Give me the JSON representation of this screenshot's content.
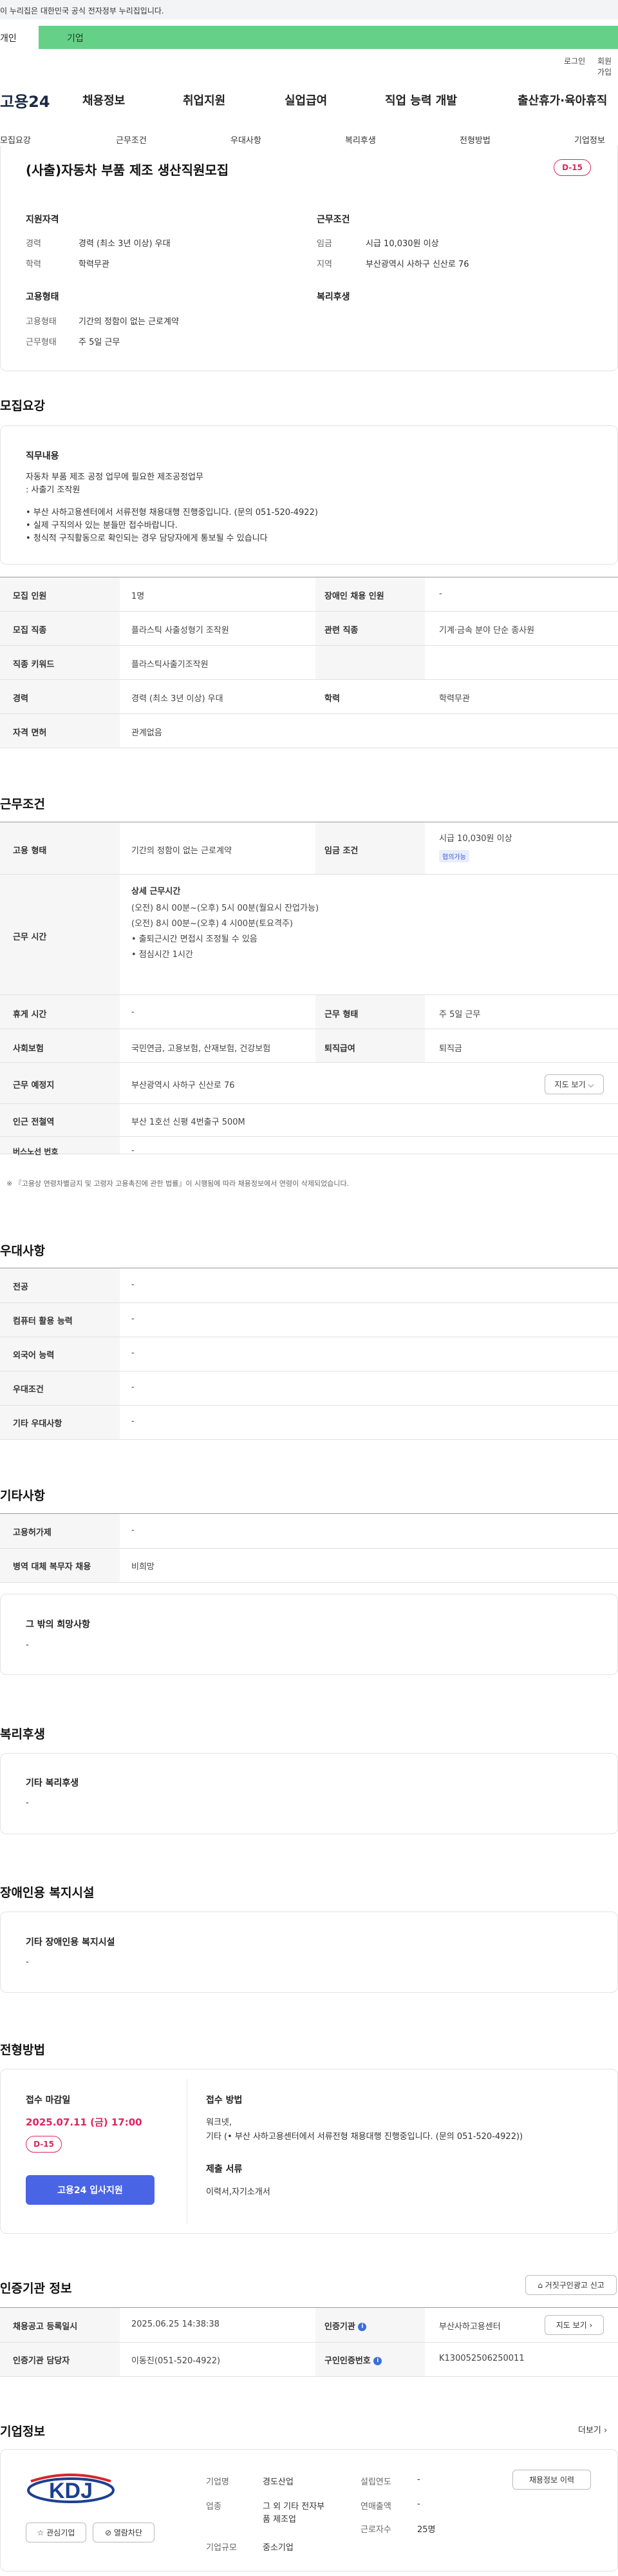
{
  "notice": "이 누리집은 대한민국 공식 전자정부 누리집입니다.",
  "top_tabs": [
    "개인",
    "기업"
  ],
  "util": [
    "로그인",
    "회원가입"
  ],
  "logo": "고용24",
  "gnb": [
    "채용정보",
    "취업지원",
    "실업급여",
    "직업 능력 개발",
    "출산휴가·육아휴직"
  ],
  "subtabs": [
    "모집요강",
    "근무조건",
    "우대사항",
    "복리후생",
    "전형방법",
    "기업정보"
  ],
  "job": {
    "title": "(사출)자동차 부품 제조 생산직원모집",
    "dday": "D-15",
    "qual_h": "지원자격",
    "work_h": "근무조건",
    "emp_h": "고용형태",
    "welfare_h": "복리후생",
    "career_k": "경력",
    "career_v": "경력 (최소 3년 이상) 우대",
    "edu_k": "학력",
    "edu_v": "학력무관",
    "wage_k": "임금",
    "wage_v": "시급 10,030원 이상",
    "region_k": "지역",
    "region_v": "부산광역시 사하구 신산로 76",
    "etype_k": "고용형태",
    "etype_v": "기간의 정함이 없는 근로계약",
    "wtype_k": "근무형태",
    "wtype_v": "주 5일 근무"
  },
  "sections": {
    "recruit": "모집요강",
    "work": "근무조건",
    "pref": "우대사항",
    "etc": "기타사항",
    "welfare": "복리후생",
    "disab": "장애인용 복지시설",
    "screen": "전형방법",
    "cert": "인증기관 정보",
    "company": "기업정보"
  },
  "duty": {
    "h": "직무내용",
    "l1": "자동차 부품 제조 공정 업무에 필요한 제조공정업무",
    "l2": ": 사출기 조작원",
    "l3": "• 부산 사하고용센터에서 서류전형 채용대행 진행중입니다. (문의 051-520-4922)",
    "l4": "• 실제 구직의사 있는 분들만 접수바랍니다.",
    "l5": "• 청식적 구직활동으로 확인되는 경우 담당자에게 통보될 수 있습니다"
  },
  "recruit_table": {
    "r1": [
      "모집 인원",
      "1명",
      "장애인 채용 인원",
      "-"
    ],
    "r2": [
      "모집 직종",
      "플라스틱 사출성형기 조작원",
      "관련 직종",
      "기계·금속 분야 단순 종사원"
    ],
    "r3": [
      "직종 키워드",
      "플라스틱사출기조작원"
    ],
    "r4": [
      "경력",
      "경력 (최소 3년 이상) 우대",
      "학력",
      "학력무관"
    ],
    "r5": [
      "자격 면허",
      "관계없음"
    ]
  },
  "work_table": {
    "etype": [
      "고용 형태",
      "기간의 정함이 없는 근로계약"
    ],
    "wage": [
      "임금 조건",
      "시급 10,030원 이상"
    ],
    "wage_chip": "협의가능",
    "hours_k": "근무 시간",
    "hours": [
      "상세 근무시간",
      "(오전) 8시 00분~(오후) 5시 00분(월요시 잔업가능)",
      "(오전) 8시 00분~(오후) 4 시00분(토요격주)",
      "• 출퇴근시간 면접시 조정될 수 있음",
      "• 점심시간 1시간"
    ],
    "leave": [
      "휴게 시간",
      "-",
      "근무 형태",
      "주 5일 근무"
    ],
    "ins": [
      "사회보험",
      "국민연금, 고용보험, 산재보험, 건강보험",
      "퇴직급여",
      "퇴직금"
    ],
    "place": [
      "근무 예정지",
      "부산광역시 사하구 신산로 76"
    ],
    "map_btn": "지도 보기 ⌵",
    "station": [
      "인근 전철역",
      "부산 1호선 신평 4번출구 500M"
    ],
    "bus": [
      "버스노선 번호",
      "-"
    ],
    "note": "※ 『고용상 연령차별금지 및 고령자 고용촉진에 관한 법률』이 시행됨에 따라 채용정보에서 연령이 삭제되었습니다."
  },
  "pref_table": [
    [
      "전공",
      "-"
    ],
    [
      "컴퓨터 활용 능력",
      "-"
    ],
    [
      "외국어 능력",
      "-"
    ],
    [
      "우대조건",
      "-"
    ],
    [
      "기타 우대사항",
      "-"
    ]
  ],
  "etc_table": [
    [
      "고용허가제",
      "-"
    ],
    [
      "병역 대체 복무자 채용",
      "비희망"
    ]
  ],
  "etc_box": {
    "h": "그 밖의 희망사항",
    "v": "-"
  },
  "welfare_box": {
    "h": "기타 복리후생",
    "v": "-"
  },
  "disab_box": {
    "h": "기타 장애인용 복지시설",
    "v": "-"
  },
  "screen_box": {
    "deadline_h": "접수 마감일",
    "deadline": "2025.07.11 (금) 17:00",
    "dday": "D-15",
    "apply": "고용24 입사지원",
    "method_h": "접수 방법",
    "method1": "워크넷,",
    "method2": "기타 (• 부산 사하고용센터에서 서류전형 채용대행 진행중입니다. (문의 051-520-4922))",
    "docs_h": "제출 서류",
    "docs": "이력서,자기소개서"
  },
  "cert": {
    "report_btn": "거짓구인광고 신고",
    "r1": [
      "채용공고 등록일시",
      "2025.06.25 14:38:38",
      "인증기관",
      "부산사하고용센터"
    ],
    "map_btn": "지도 보기 ›",
    "r2": [
      "인증기관 담당자",
      "이동진(051-520-4922)",
      "구인인증번호",
      "K130052506250011"
    ]
  },
  "company": {
    "more": "더보기 ›",
    "logo": "KDJ",
    "fav": "☆ 관심기업",
    "block": "⊘ 열람차단",
    "ind_k": "기업명",
    "ind_v": "경도산업",
    "est_k": "설립연도",
    "est_v": "-",
    "biz_k": "업종",
    "biz_v1": "그 외 기타 전자부",
    "biz_v2": "품 제조업",
    "sales_k": "연매출액",
    "sales_v": "-",
    "emp_k": "근로자수",
    "emp_v": "25명",
    "size_k": "기업규모",
    "size_v": "중소기업",
    "recruit_btn": "채용정보 이력"
  }
}
